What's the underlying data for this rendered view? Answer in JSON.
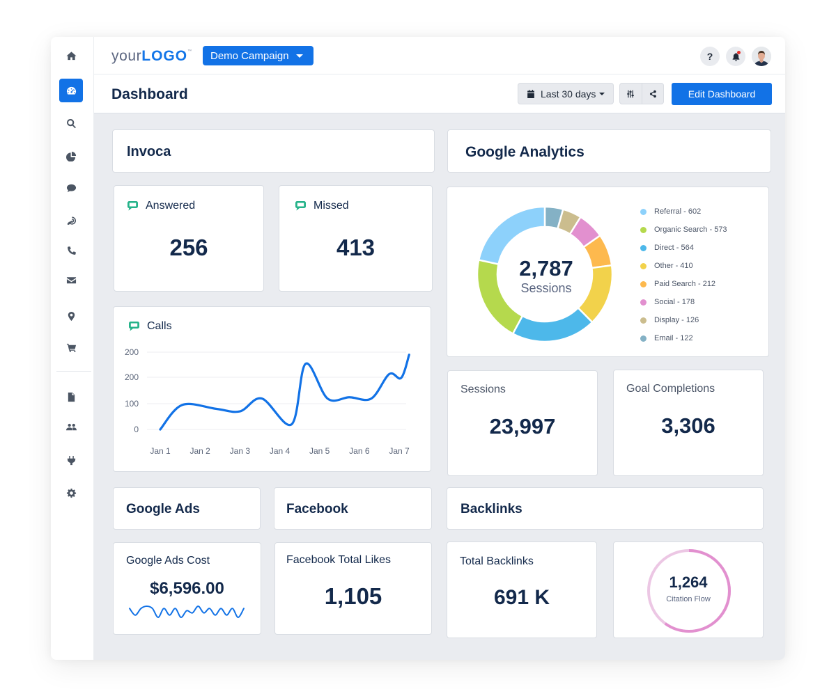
{
  "topbar": {
    "logo_prefix": "your",
    "logo_brand": "LOGO",
    "logo_tm": "™",
    "campaign_selector": "Demo Campaign",
    "help_label": "?",
    "notification_badge": true
  },
  "sidebar": {
    "items": [
      {
        "name": "home",
        "icon": "home-icon"
      },
      {
        "name": "dashboard",
        "icon": "dashboard-icon",
        "active": true
      },
      {
        "name": "search",
        "icon": "search-icon"
      },
      {
        "name": "reports",
        "icon": "pie-chart-icon"
      },
      {
        "name": "comments",
        "icon": "chat-bubble-icon"
      },
      {
        "name": "targeting",
        "icon": "target-icon"
      },
      {
        "name": "calls",
        "icon": "phone-icon"
      },
      {
        "name": "email",
        "icon": "envelope-icon"
      },
      {
        "name": "location",
        "icon": "map-marker-icon"
      },
      {
        "name": "ecommerce",
        "icon": "shopping-cart-icon"
      },
      {
        "name": "documents",
        "icon": "file-icon"
      },
      {
        "name": "users",
        "icon": "users-icon"
      },
      {
        "name": "integrations",
        "icon": "plug-icon"
      },
      {
        "name": "settings",
        "icon": "gear-icon"
      }
    ]
  },
  "pagehead": {
    "title": "Dashboard",
    "date_range": "Last 30 days",
    "edit_button": "Edit Dashboard"
  },
  "invoca": {
    "title": "Invoca",
    "answered_label": "Answered",
    "answered_value": "256",
    "missed_label": "Missed",
    "missed_value": "413",
    "calls_label": "Calls"
  },
  "google_analytics": {
    "title": "Google Analytics",
    "donut_total": "2,787",
    "donut_label": "Sessions",
    "sessions_label": "Sessions",
    "sessions_value": "23,997",
    "goals_label": "Goal Completions",
    "goals_value": "3,306"
  },
  "google_ads": {
    "title": "Google Ads",
    "cost_label": "Google Ads Cost",
    "cost_value": "$6,596.00"
  },
  "facebook": {
    "title": "Facebook",
    "likes_label": "Facebook Total Likes",
    "likes_value": "1,105"
  },
  "backlinks": {
    "title": "Backlinks",
    "total_label": "Total Backlinks",
    "total_value": "691 K",
    "citation_value": "1,264",
    "citation_label": "Citation Flow",
    "citation_fill_fraction": 0.6,
    "ring_color": "#e290cf",
    "ring_track_color": "#ecc7e4"
  },
  "chart_data": [
    {
      "type": "line",
      "title": "Calls",
      "categories": [
        "Jan 1",
        "Jan 2",
        "Jan 3",
        "Jan 4",
        "Jan 5",
        "Jan 6",
        "Jan 7"
      ],
      "x": [
        0,
        0.55,
        1,
        1.5,
        2,
        2.65,
        3.1,
        3.55,
        3.95,
        4.3,
        4.75,
        5,
        5.5,
        5.9,
        6.1,
        6.3,
        6.6
      ],
      "series": [
        {
          "name": "Calls",
          "values": [
            0,
            95,
            80,
            70,
            120,
            20,
            255,
            120,
            125,
            120,
            215,
            200,
            290
          ],
          "x": [
            0,
            0.55,
            1.4,
            2,
            2.55,
            3.3,
            3.65,
            4.2,
            4.75,
            5.3,
            5.75,
            6.05,
            6.25
          ],
          "color": "#1272e6"
        }
      ],
      "ytick_labels": [
        "0",
        "100",
        "200",
        "200"
      ],
      "ytick_values": [
        0,
        100,
        200,
        300
      ],
      "ylim": [
        0,
        300
      ],
      "grid": true
    },
    {
      "type": "pie",
      "title": "Sessions",
      "total_label": "2,787",
      "slices": [
        {
          "label": "Referral",
          "value": 602,
          "color": "#8dd1fb"
        },
        {
          "label": "Organic Search",
          "value": 573,
          "color": "#b5d94d"
        },
        {
          "label": "Direct",
          "value": 564,
          "color": "#4db8ea"
        },
        {
          "label": "Other",
          "value": 410,
          "color": "#f2d24b"
        },
        {
          "label": "Paid Search",
          "value": 212,
          "color": "#fdb94e"
        },
        {
          "label": "Social",
          "value": 178,
          "color": "#e290cf"
        },
        {
          "label": "Display",
          "value": 126,
          "color": "#cbbd8e"
        },
        {
          "label": "Email",
          "value": 122,
          "color": "#84b1c5"
        }
      ],
      "legend_position": "right"
    },
    {
      "type": "line",
      "title": "Google Ads Cost sparkline",
      "values": [
        6,
        3,
        6,
        7,
        6,
        2,
        6,
        3,
        6,
        2,
        5,
        4,
        7,
        4,
        6,
        3,
        6,
        3,
        6,
        2,
        6
      ],
      "color": "#1272e6"
    }
  ]
}
